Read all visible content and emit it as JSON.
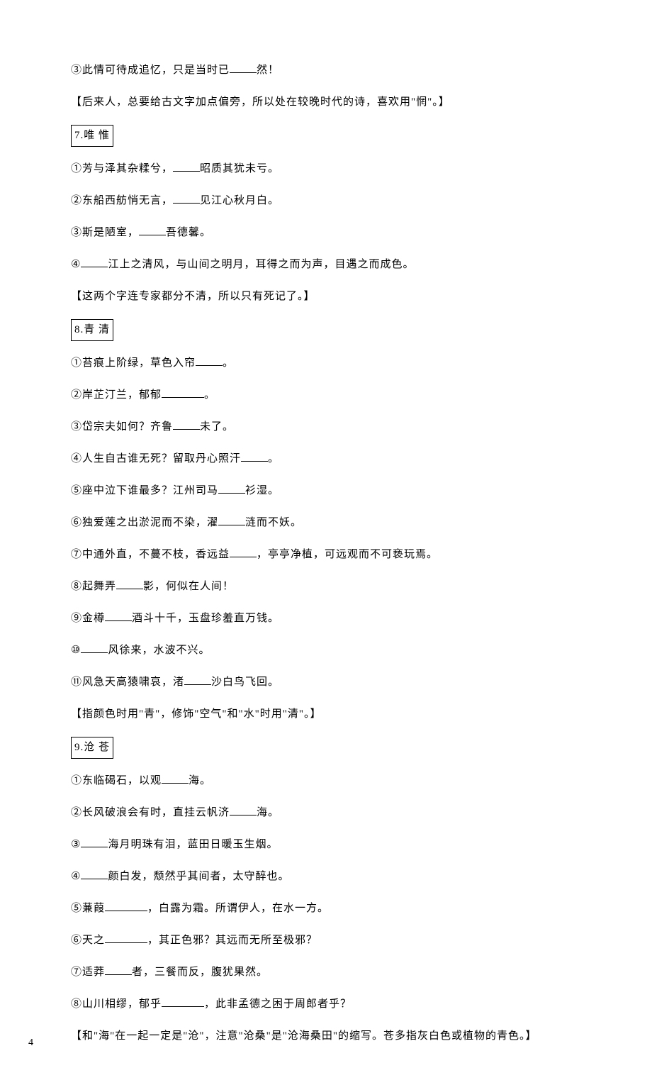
{
  "l1a": "③此情可待成追忆，只是当时已",
  "l1b": "然！",
  "l2": "【后来人，总要给古文字加点偏旁，所以处在较晚时代的诗，喜欢用\"惘\"。】",
  "h7": "7.唯 惟",
  "s7_1a": "①芳与泽其杂糅兮，",
  "s7_1b": "昭质其犹未亏。",
  "s7_2a": "②东船西舫悄无言，",
  "s7_2b": "见江心秋月白。",
  "s7_3a": "③斯是陋室，",
  "s7_3b": "吾德馨。",
  "s7_4a": "④",
  "s7_4b": "江上之清风，与山间之明月，耳得之而为声，目遇之而成色。",
  "note7": "【这两个字连专家都分不清，所以只有死记了。】",
  "h8": "8.青 清",
  "s8_1a": "①苔痕上阶绿，草色入帘",
  "s8_1b": "。",
  "s8_2a": "②岸芷汀兰，郁郁",
  "s8_2b": "。",
  "s8_3a": "③岱宗夫如何？齐鲁",
  "s8_3b": "未了。",
  "s8_4a": "④人生自古谁无死？留取丹心照汗",
  "s8_4b": "。",
  "s8_5a": "⑤座中泣下谁最多？江州司马",
  "s8_5b": "衫湿。",
  "s8_6a": "⑥独爱莲之出淤泥而不染，濯",
  "s8_6b": "涟而不妖。",
  "s8_7a": "⑦中通外直，不蔓不枝，香远益",
  "s8_7b": "，亭亭净植，可远观而不可亵玩焉。",
  "s8_8a": "⑧起舞弄",
  "s8_8b": "影，何似在人间！",
  "s8_9a": "⑨金樽",
  "s8_9b": "酒斗十千，玉盘珍羞直万钱。",
  "s8_10a": "⑩",
  "s8_10b": "风徐来，水波不兴。",
  "s8_11a": "⑪风急天高猿啸哀，渚",
  "s8_11b": "沙白鸟飞回。",
  "note8": "【指颜色时用\"青\"，修饰\"空气\"和\"水\"时用\"清\"。】",
  "h9": "9.沧 苍",
  "s9_1a": "①东临碣石，以观",
  "s9_1b": "海。",
  "s9_2a": "②长风破浪会有时，直挂云帆济",
  "s9_2b": "海。",
  "s9_3a": "③",
  "s9_3b": "海月明珠有泪，蓝田日暖玉生烟。",
  "s9_4a": "④",
  "s9_4b": "颜白发，颓然乎其间者，太守醉也。",
  "s9_5a": "⑤蒹葭",
  "s9_5b": "，白露为霜。所谓伊人，在水一方。",
  "s9_6a": "⑥天之",
  "s9_6b": "，其正色邪？其远而无所至极邪？",
  "s9_7a": "⑦适莽",
  "s9_7b": "者，三餐而反，腹犹果然。",
  "s9_8a": "⑧山川相缪，郁乎",
  "s9_8b": "，此非孟德之困于周郎者乎？",
  "note9": "【和\"海\"在一起一定是\"沧\"，注意\"沧桑\"是\"沧海桑田\"的缩写。苍多指灰白色或植物的青色。】",
  "pagenum": "4"
}
